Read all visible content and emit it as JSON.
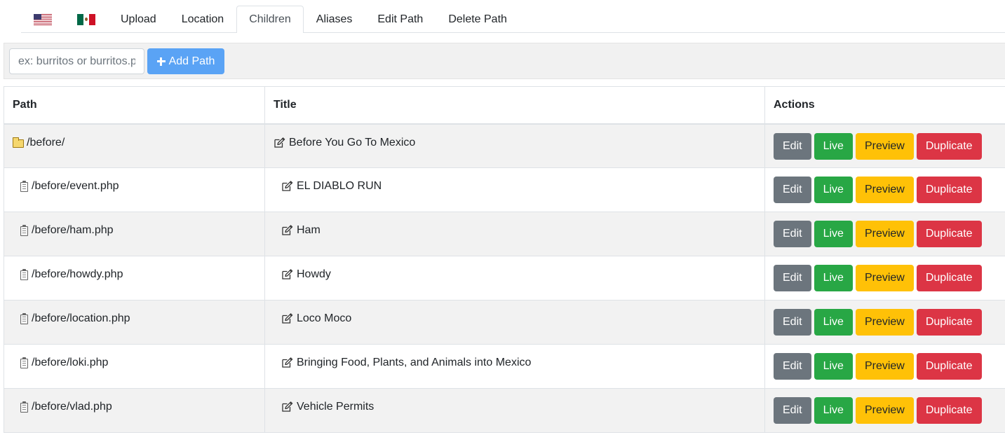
{
  "tabs": [
    {
      "type": "flag",
      "flag": "us-flag-icon"
    },
    {
      "type": "flag",
      "flag": "mx-flag-icon"
    },
    {
      "type": "text",
      "label": "Upload"
    },
    {
      "type": "text",
      "label": "Location"
    },
    {
      "type": "text",
      "label": "Children",
      "active": true
    },
    {
      "type": "text",
      "label": "Aliases"
    },
    {
      "type": "text",
      "label": "Edit Path"
    },
    {
      "type": "text",
      "label": "Delete Path"
    }
  ],
  "toolbar": {
    "search_placeholder": "ex: burritos or burritos.php",
    "search_value": "",
    "add_label": "Add Path",
    "add_color": "#5aa3f5"
  },
  "table": {
    "headers": [
      "Path",
      "Title",
      "Actions"
    ],
    "rows": [
      {
        "icon": "folder-icon",
        "path": "/before/",
        "title": "Before You Go To Mexico",
        "child": false
      },
      {
        "icon": "file-icon",
        "path": "/before/event.php",
        "title": "EL DIABLO RUN",
        "child": true
      },
      {
        "icon": "file-icon",
        "path": "/before/ham.php",
        "title": "Ham",
        "child": true
      },
      {
        "icon": "file-icon",
        "path": "/before/howdy.php",
        "title": "Howdy",
        "child": true
      },
      {
        "icon": "file-icon",
        "path": "/before/location.php",
        "title": "Loco Moco",
        "child": true
      },
      {
        "icon": "file-icon",
        "path": "/before/loki.php",
        "title": "Bringing Food, Plants, and Animals into Mexico",
        "child": true
      },
      {
        "icon": "file-icon",
        "path": "/before/vlad.php",
        "title": "Vehicle Permits",
        "child": true
      }
    ],
    "actions": {
      "edit": "Edit",
      "live": "Live",
      "preview": "Preview",
      "duplicate": "Duplicate"
    }
  },
  "colors": {
    "edit": "#6c757d",
    "live": "#28a745",
    "preview": "#ffc107",
    "duplicate": "#dc3545",
    "row_stripe": "#f2f2f2"
  }
}
